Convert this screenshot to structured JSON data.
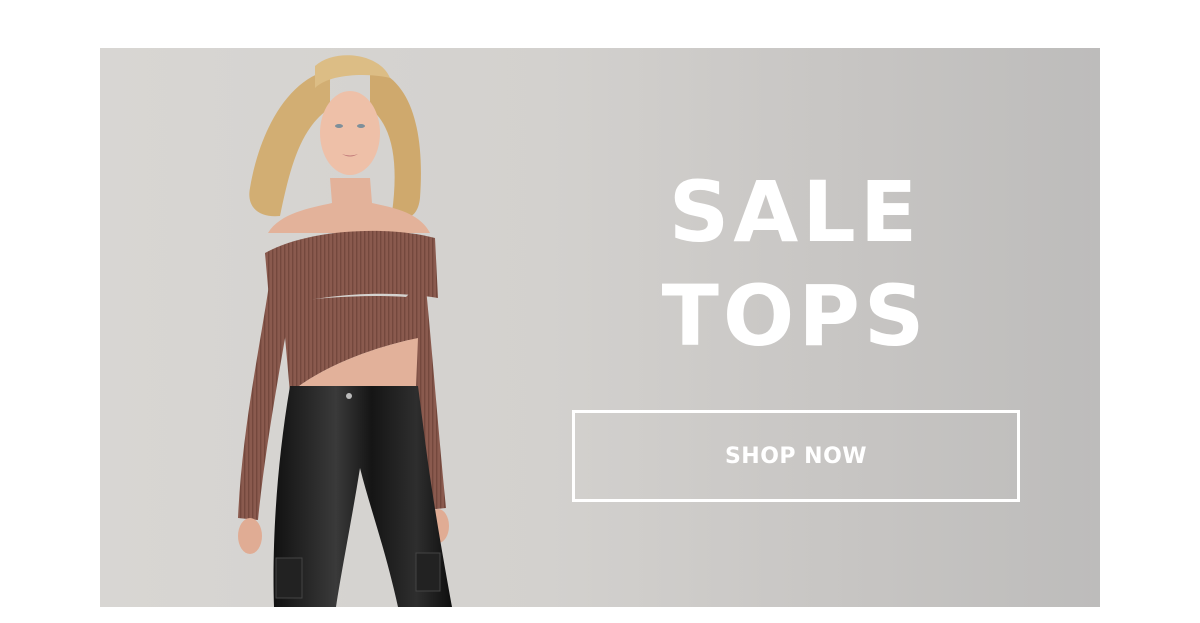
{
  "banner": {
    "headline_line1": "SALE",
    "headline_line2": "TOPS",
    "cta_label": "SHOP NOW",
    "image_alt": "Model wearing a brown off-the-shoulder ribbed crop sweater and black faux leather cargo pants"
  },
  "colors": {
    "background_left": "#d8d6d3",
    "background_right": "#bdbcbb",
    "text": "#ffffff",
    "sweater": "#8a5a4e",
    "pants": "#1e1e1e",
    "hair": "#d7b57a",
    "skin": "#e7b8a0"
  }
}
